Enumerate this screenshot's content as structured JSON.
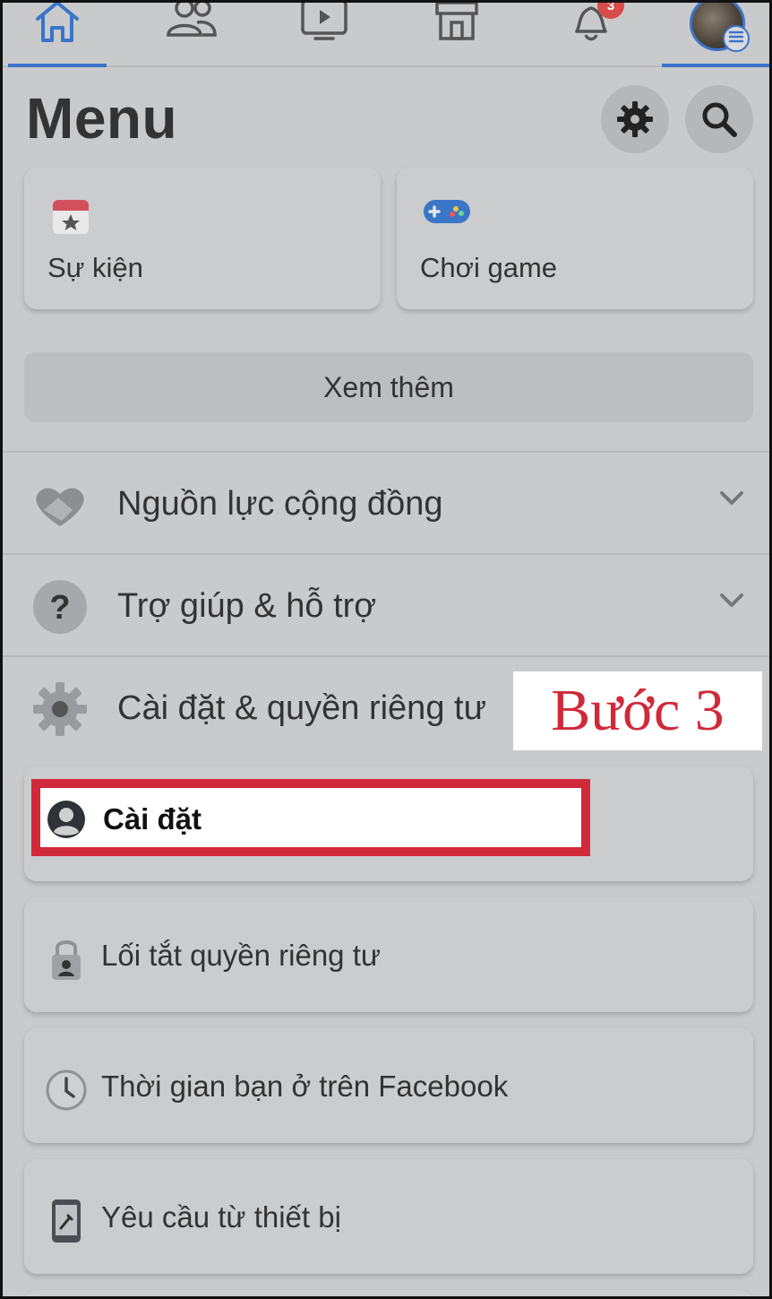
{
  "nav": {
    "notification_count": "3",
    "icons": [
      "home-icon",
      "friends-icon",
      "watch-icon",
      "marketplace-icon",
      "bell-icon",
      "profile-avatar"
    ]
  },
  "header": {
    "title": "Menu"
  },
  "shortcuts": [
    {
      "label": "Sự kiện",
      "icon": "calendar-star-icon"
    },
    {
      "label": "Chơi game",
      "icon": "gamepad-icon"
    }
  ],
  "see_more": "Xem thêm",
  "sections": [
    {
      "label": "Nguồn lực cộng đồng",
      "icon": "handshake-icon"
    },
    {
      "label": "Trợ giúp & hỗ trợ",
      "icon": "question-icon"
    },
    {
      "label": "Cài đặt & quyền riêng tư",
      "icon": "gear-icon"
    }
  ],
  "settings_items": [
    {
      "label": "Cài đặt",
      "icon": "person-circle-icon"
    },
    {
      "label": "Lối tắt quyền riêng tư",
      "icon": "lock-icon"
    },
    {
      "label": "Thời gian bạn ở trên Facebook",
      "icon": "clock-icon"
    },
    {
      "label": "Yêu cầu từ thiết bị",
      "icon": "phone-icon"
    }
  ],
  "annotation": {
    "step": "Bước 3"
  },
  "colors": {
    "accent": "#3b74c9",
    "highlight": "#d0293a",
    "overlay": "#c9cacc"
  }
}
